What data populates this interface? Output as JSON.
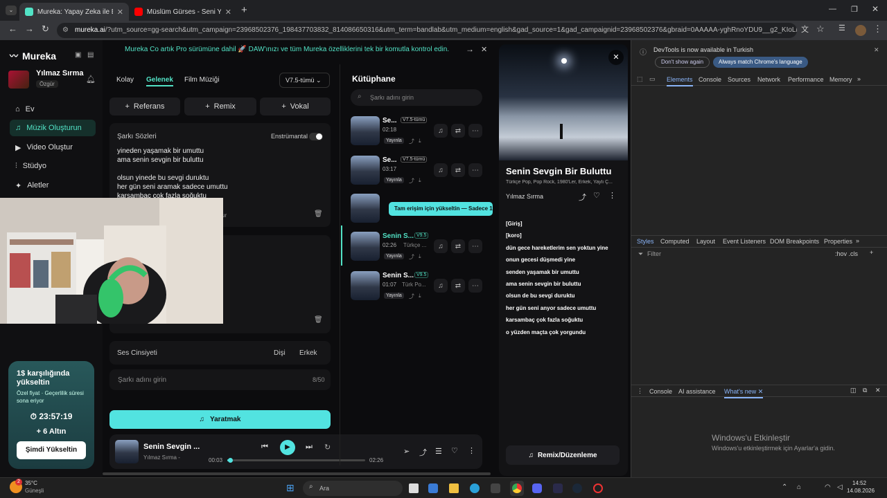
{
  "tabs": [
    {
      "title": "Mureka: Yapay Zeka ile Benzersiz",
      "active": true
    },
    {
      "title": "Müslüm Gürses - Seni Yazdım ·",
      "active": false
    }
  ],
  "url": {
    "host": "mureka.ai",
    "path": "/?utm_source=gg-search&utm_campaign=23968502376_198437703832_814086650316&utm_term=bandlab&utm_medium=english&gad_source=1&gad_campaignid=23968502376&gbraid=0AAAAA-yghRnoYDU9__g2_KIoLiI6fdmFe&gclid=..."
  },
  "banner": "Mureka Co artık Pro sürümüne dahil 🚀 DAW'ınızı ve tüm Mureka özelliklerini tek bir komutla kontrol edin.",
  "brand": "Mureka",
  "user": {
    "name": "Yılmaz Sırma",
    "plan": "Özgür"
  },
  "nav": [
    "Ev",
    "Müzik Oluşturun",
    "Video Oluştur",
    "Stüdyo",
    "Aletler"
  ],
  "upgrade": {
    "title": "1$ karşılığında yükseltin",
    "sub": "Özel fiyat · Geçerlilik süresi sona eriyor",
    "timer": "23:57:19",
    "gold": "+ 6 Altın",
    "button": "Şimdi Yükseltin"
  },
  "modes": {
    "tabs": [
      "Kolay",
      "Gelenek",
      "Film Müziği"
    ],
    "active": "Gelenek",
    "version": "V7.5-tümü"
  },
  "refs": [
    "Referans",
    "Remix",
    "Vokal"
  ],
  "lyrics": {
    "label": "Şarkı Sözleri",
    "instrumental": "Enstrümantal",
    "lines": [
      "yineden yaşamak bir umuttu",
      "ama senin sevgin bir buluttu",
      "",
      "olsun yinede bu sevgi duruktu",
      "her gün seni aramak sadece umuttu",
      "karsambaç çok fazla soğuktu"
    ],
    "partial": "ur"
  },
  "voice": {
    "label": "Ses Cinsiyeti",
    "options": [
      "Dişi",
      "Erkek"
    ]
  },
  "songname": {
    "placeholder": "Şarkı adını girin",
    "count": "8/50"
  },
  "create": "Yaratmak",
  "player": {
    "title": "Senin Sevgin ...",
    "artist": "Yılmaz Sırma -",
    "elapsed": "00:03",
    "total": "02:26",
    "progress": 0.02
  },
  "library": {
    "title": "Kütüphane",
    "search": "Şarkı adını girin",
    "publish": "Yayınla",
    "promo": "Tam erişim için yükseltin — Sadece 1",
    "items": [
      {
        "title": "Se...",
        "tag": "V7.5-tümü",
        "dur": "02:18",
        "genre": ""
      },
      {
        "title": "Se...",
        "tag": "V7.5-tümü",
        "dur": "03:17",
        "genre": ""
      },
      {
        "title": "Senin S...",
        "tag": "V9.5",
        "dur": "02:26",
        "genre": "Türkçe ..."
      },
      {
        "title": "Senin S...",
        "tag": "V9.5",
        "dur": "01:07",
        "genre": "Türk Po..."
      }
    ]
  },
  "detail": {
    "title": "Senin Sevgin Bir Buluttu",
    "tags": "Türkçe Pop, Pop Rock, 1980'Ler, Erkek, Yaylı Ç...",
    "artist": "Yılmaz Sırma",
    "lyrics": [
      "[Giriş]",
      "[koro]",
      "dün gece hareketlerim sen yoktun yine",
      "onun gecesi düşmedi yine",
      "senden yaşamak bir umuttu",
      "ama senin sevgin bir buluttu",
      "olsun de bu sevgi duruktu",
      "her gün seni anyor sadece umuttu",
      "karsambaç çok fazla soğuktu",
      "o yüzden maçta çok yorgundu"
    ],
    "button": "Remix/Düzenleme"
  },
  "devtools": {
    "notice": "DevTools is now available in Turkish",
    "btn1": "Don't show again",
    "btn2": "Always match Chrome's language",
    "tabs": [
      "Elements",
      "Console",
      "Sources",
      "Network",
      "Performance",
      "Memory"
    ],
    "stabs": [
      "Styles",
      "Computed",
      "Layout",
      "Event Listeners",
      "DOM Breakpoints",
      "Properties"
    ],
    "filter": "Filter",
    "hov": ":hov .cls",
    "drawer": [
      "Console",
      "AI assistance",
      "What's new"
    ],
    "wm1": "Windows'u Etkinleştir",
    "wm2": "Windows'u etkinleştirmek için Ayarlar'a gidin."
  },
  "taskbar": {
    "temp": "35°C",
    "weather": "Güneşli",
    "badge": "2",
    "search": "Ara",
    "time": "14:52",
    "date": "14.08.2026"
  }
}
